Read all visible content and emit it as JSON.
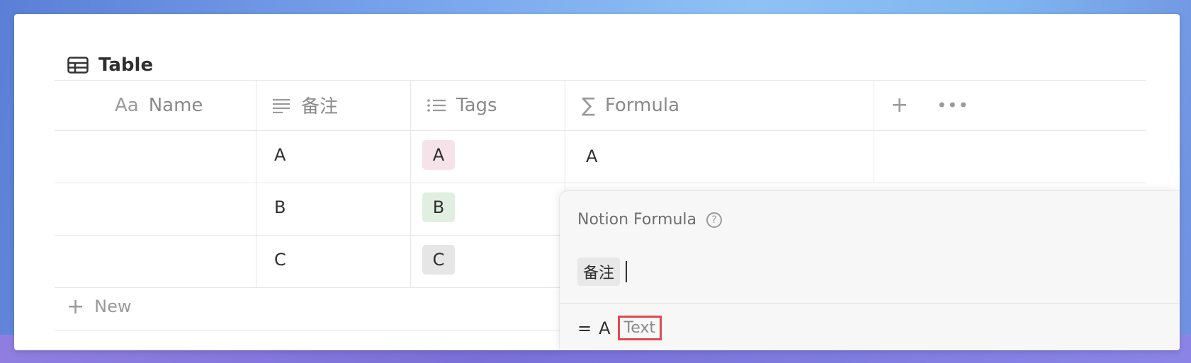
{
  "database": {
    "title": "Table",
    "title_icon": "table-icon"
  },
  "columns": [
    {
      "label": "Name",
      "icon_text": "Aa",
      "icon": "title-property-icon"
    },
    {
      "label": "备注",
      "icon": "text-lines-icon"
    },
    {
      "label": "Tags",
      "icon": "bulleted-list-icon"
    },
    {
      "label": "Formula",
      "icon": "sigma-icon"
    }
  ],
  "header_actions": {
    "add": "add-property-icon",
    "more": "more-options-icon"
  },
  "rows": [
    {
      "name": "",
      "note": "A",
      "tag": "A",
      "formula": "A"
    },
    {
      "name": "",
      "note": "B",
      "tag": "B",
      "formula": ""
    },
    {
      "name": "",
      "note": "C",
      "tag": "C",
      "formula": ""
    }
  ],
  "tag_colors": {
    "A": "#f6e3ea",
    "B": "#e1efe1",
    "C": "#e6e6e6"
  },
  "new_row_label": "New",
  "formula_popup": {
    "title": "Notion Formula",
    "expression_chip": "备注",
    "result_prefix": "=",
    "result_value": "A",
    "result_type": "Text",
    "highlight_color": "#e04a4a"
  }
}
